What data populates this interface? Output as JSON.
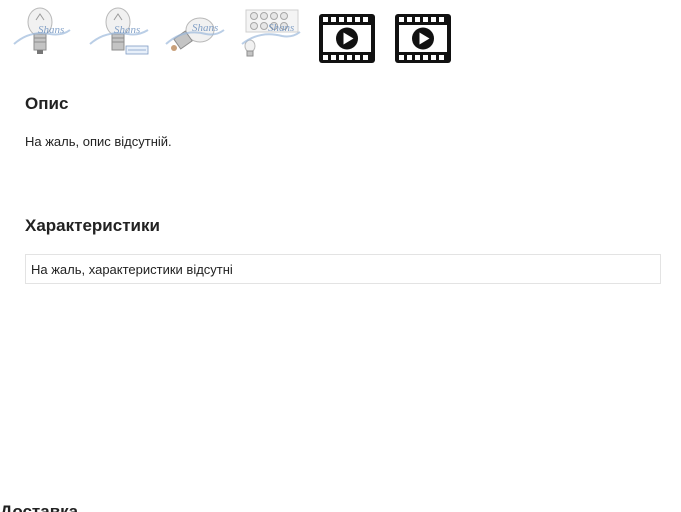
{
  "gallery": {
    "thumbnails": [
      {
        "kind": "image",
        "icon": "bulb-photo-icon"
      },
      {
        "kind": "image",
        "icon": "bulb-photo-icon"
      },
      {
        "kind": "image",
        "icon": "bulb-photo-icon"
      },
      {
        "kind": "image",
        "icon": "bulb-pack-photo-icon"
      },
      {
        "kind": "video",
        "icon": "video-film-icon"
      },
      {
        "kind": "video",
        "icon": "video-film-icon"
      }
    ],
    "watermark": "Shans"
  },
  "description": {
    "title": "Опис",
    "text": "На жаль, опис відсутній."
  },
  "specifications": {
    "title": "Характеристики",
    "empty_text": "На жаль, характеристики відсутні"
  },
  "delivery": {
    "title": "Доставка"
  }
}
